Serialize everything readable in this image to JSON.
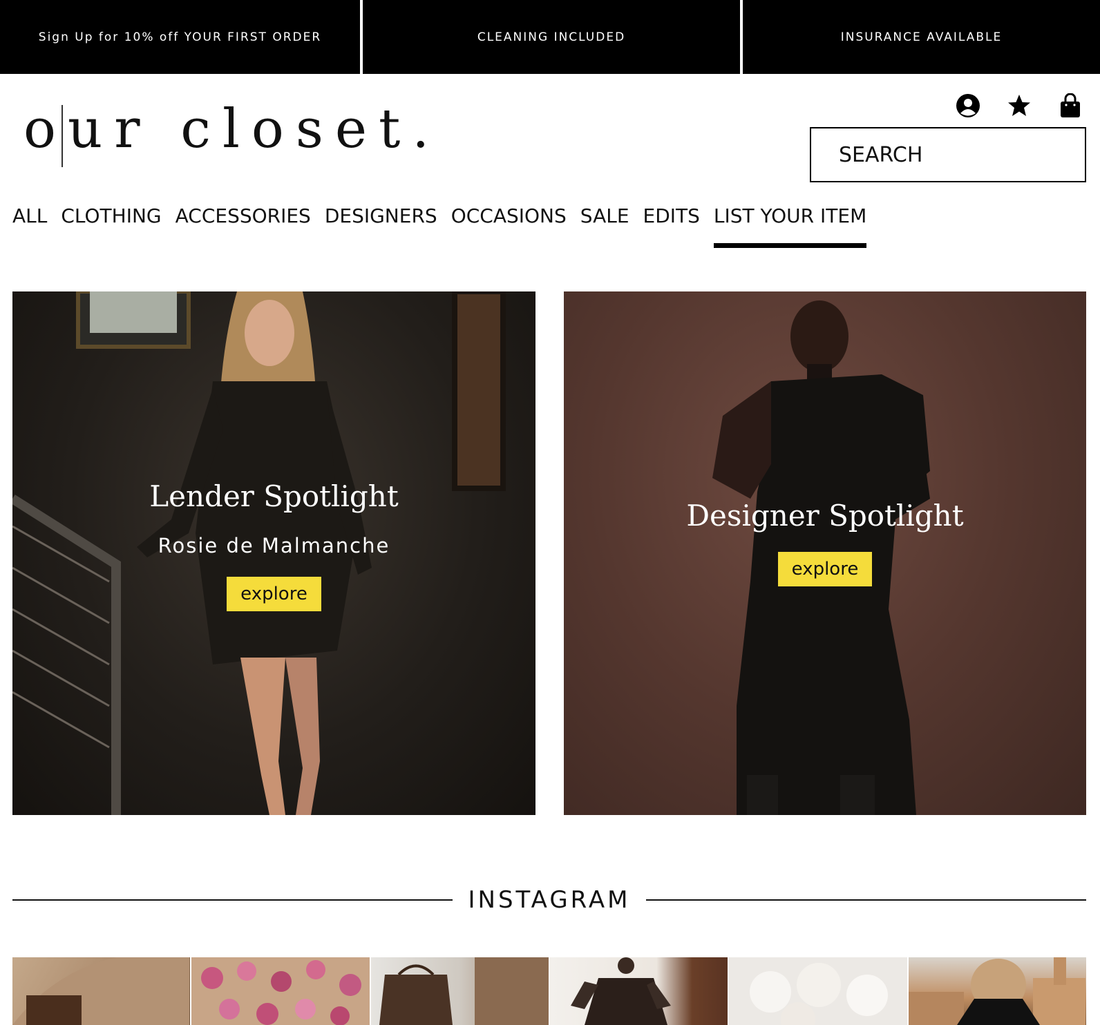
{
  "promo": [
    "Sign Up for 10% off YOUR FIRST ORDER",
    "CLEANING INCLUDED",
    "INSURANCE AVAILABLE"
  ],
  "logo": {
    "text": "our closet."
  },
  "header": {
    "icons": [
      "account-icon",
      "favorites-star-icon",
      "shopping-bag-icon"
    ],
    "search_placeholder": "SEARCH"
  },
  "nav": {
    "items": [
      "ALL",
      "CLOTHING",
      "ACCESSORIES",
      "DESIGNERS",
      "OCCASIONS",
      "SALE",
      "EDITS",
      "LIST YOUR ITEM"
    ],
    "active": "LIST YOUR ITEM"
  },
  "lender_spotlight": {
    "title": "Lender Spotlight",
    "subtitle": "Rosie de Malmanche",
    "button": "explore"
  },
  "designer_spotlight": {
    "title": "Designer Spotlight",
    "button": "explore"
  },
  "instagram": {
    "heading": "INSTAGRAM",
    "tiles": [
      "camel coat bag",
      "pink peonies",
      "monogram tote",
      "lace dress",
      "white roses",
      "hair bun city view"
    ]
  },
  "colors": {
    "accent_button": "#f5dc3b",
    "promo_bg": "#000000"
  }
}
